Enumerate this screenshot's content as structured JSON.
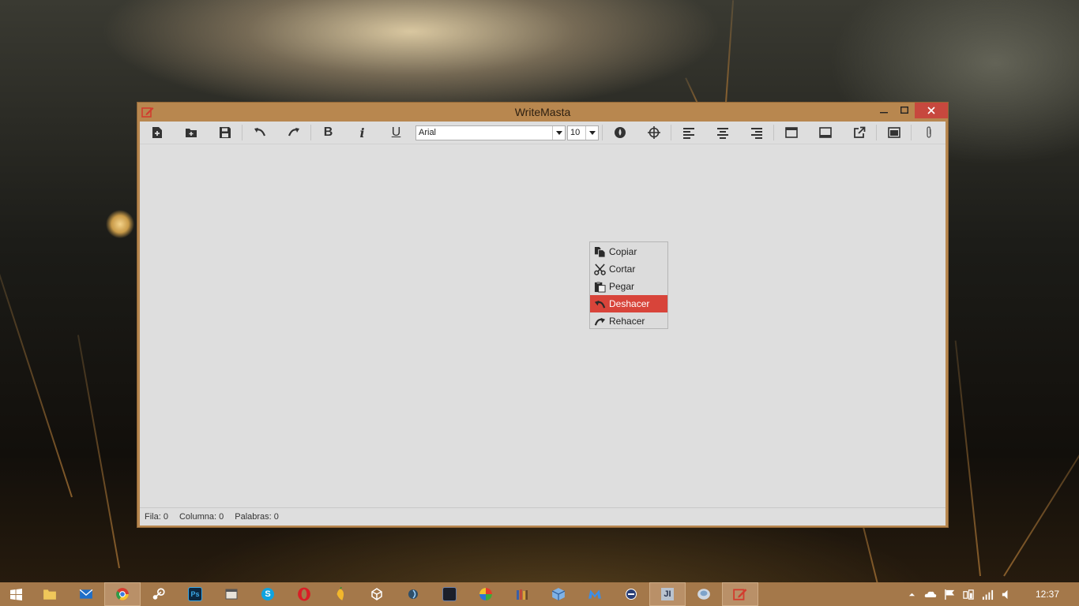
{
  "window": {
    "title": "WriteMasta"
  },
  "toolbar": {
    "bold": "B",
    "italic": "i",
    "underline": "U",
    "font_family": "Arial",
    "font_size": "10"
  },
  "context_menu": {
    "items": [
      {
        "label": "Copiar",
        "icon": "copy-icon"
      },
      {
        "label": "Cortar",
        "icon": "scissors-icon"
      },
      {
        "label": "Pegar",
        "icon": "paste-icon"
      },
      {
        "label": "Deshacer",
        "icon": "undo-icon",
        "highlighted": true
      },
      {
        "label": "Rehacer",
        "icon": "redo-icon"
      }
    ]
  },
  "status": {
    "row": "Fila: 0",
    "column": "Columna: 0",
    "words": "Palabras: 0"
  },
  "taskbar": {
    "clock": "12:37",
    "accent": "#a4784a"
  },
  "colors": {
    "window_frame": "#b8874f",
    "close_button": "#c7483e",
    "menu_highlight": "#d8443a"
  }
}
